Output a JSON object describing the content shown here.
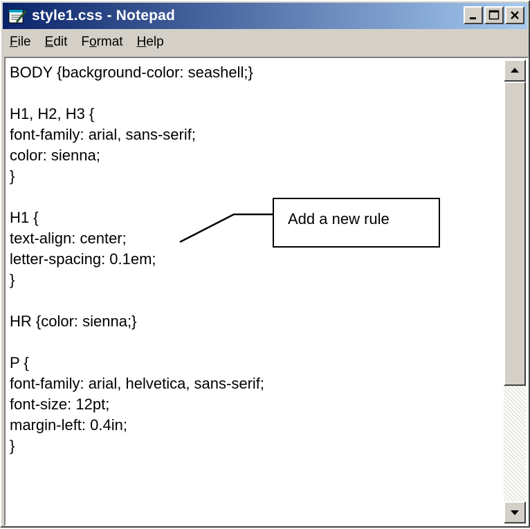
{
  "window": {
    "title": "style1.css - Notepad"
  },
  "menu": {
    "items": [
      {
        "label_u": "F",
        "label_rest": "ile"
      },
      {
        "label_u": "E",
        "label_rest": "dit"
      },
      {
        "label_pre": "F",
        "label_u": "o",
        "label_rest": "rmat"
      },
      {
        "label_u": "H",
        "label_rest": "elp"
      }
    ]
  },
  "editor": {
    "lines": [
      "BODY {background-color: seashell;}",
      "",
      "H1, H2, H3 {",
      "font-family: arial, sans-serif;",
      "color: sienna;",
      "}",
      "",
      "H1 {",
      "text-align: center;",
      "letter-spacing: 0.1em;",
      "}",
      "",
      "HR {color: sienna;}",
      "",
      "P {",
      "font-family: arial, helvetica, sans-serif;",
      "font-size: 12pt;",
      "margin-left: 0.4in;",
      "}"
    ]
  },
  "callout": {
    "text": "Add a new rule"
  },
  "icons": {
    "app": "notepad-icon",
    "minimize": "minimize-icon",
    "maximize": "maximize-icon",
    "close": "close-icon",
    "scroll_up": "arrow-up-icon",
    "scroll_down": "arrow-down-icon"
  }
}
